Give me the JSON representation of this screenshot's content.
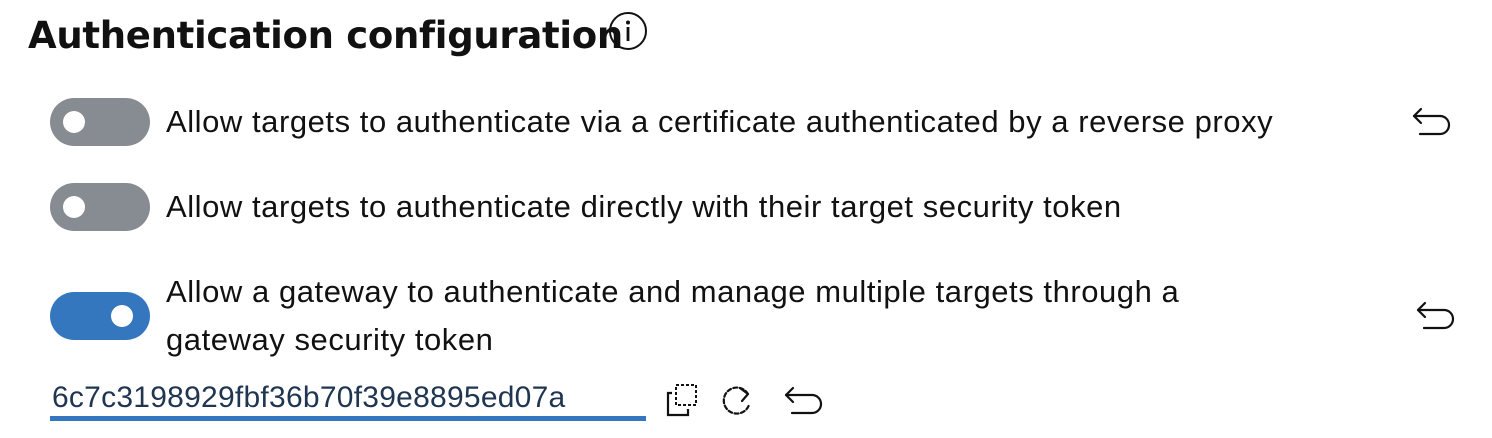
{
  "heading": {
    "title": "Authentication configuration",
    "info_icon": "info-circle-icon"
  },
  "options": [
    {
      "label": "Allow targets to authenticate via a certificate authenticated by a reverse proxy",
      "enabled": false,
      "has_undo": true
    },
    {
      "label": "Allow targets to authenticate directly with their target security token",
      "enabled": false,
      "has_undo": false
    },
    {
      "label_line1": "Allow a gateway to authenticate and manage multiple targets through a",
      "label_line2": "gateway security token",
      "enabled": true,
      "has_undo": true
    }
  ],
  "gateway_token": {
    "value": "6c7c3198929fbf36b70f39e8895ed07a",
    "icons": [
      "copy-icon",
      "regenerate-icon",
      "undo-icon"
    ]
  },
  "colors": {
    "toggle_on": "#3477be",
    "toggle_off": "#878b92",
    "text": "#111111"
  }
}
